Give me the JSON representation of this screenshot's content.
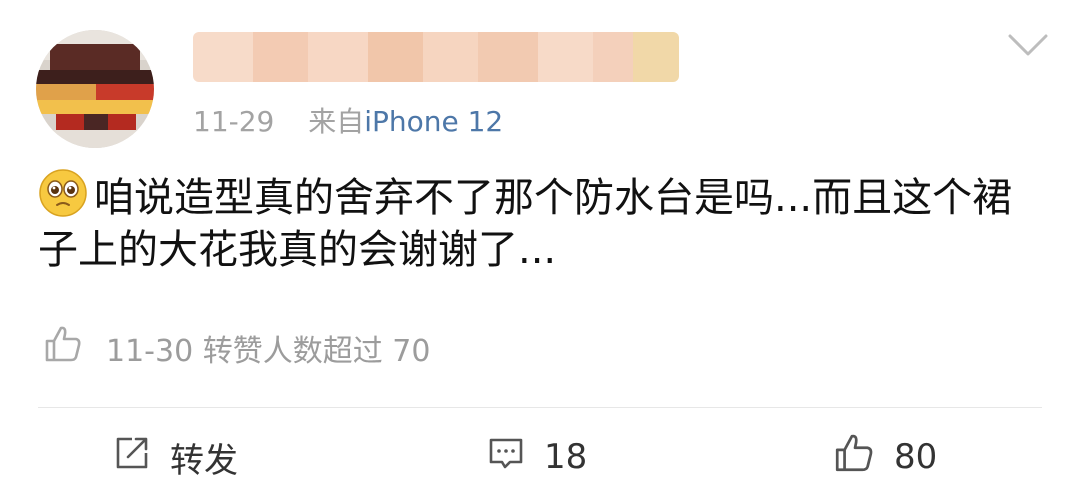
{
  "post": {
    "date": "11-29",
    "source_prefix": "来自",
    "source_device": "iPhone 12",
    "content_text": "咱说造型真的舍弃不了那个防水台是吗...而且这个裙子上的大花我真的会谢谢了...",
    "emoji_icon": "pleading-face-icon"
  },
  "likes_row": {
    "text": "11-30 转赞人数超过 70"
  },
  "actions": {
    "repost_label": "转发",
    "comment_count": "18",
    "like_count": "80"
  },
  "colors": {
    "meta_gray": "#a3a3a3",
    "source_link": "#4d77a8",
    "text": "#111111",
    "action_text": "#333333",
    "divider": "#e7e7e7"
  }
}
